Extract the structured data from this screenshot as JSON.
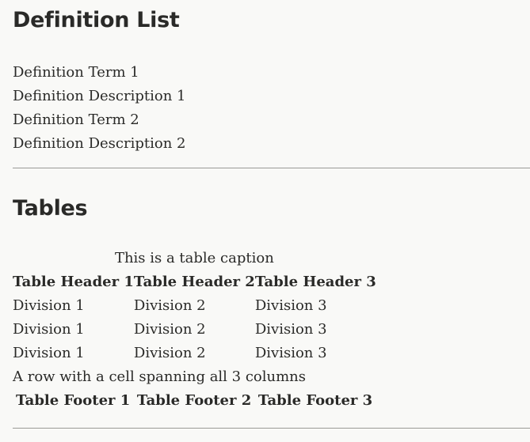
{
  "definition_list": {
    "heading": "Definition List",
    "items": [
      {
        "term": "Definition Term 1",
        "description": "Definition Description 1"
      },
      {
        "term": "Definition Term 2",
        "description": "Definition Description 2"
      }
    ]
  },
  "tables_section": {
    "heading": "Tables",
    "caption": "This is a table caption",
    "headers": [
      "Table Header 1",
      "Table Header 2",
      "Table Header 3"
    ],
    "rows": [
      [
        "Division 1",
        "Division 2",
        "Division 3"
      ],
      [
        "Division 1",
        "Division 2",
        "Division 3"
      ],
      [
        "Division 1",
        "Division 2",
        "Division 3"
      ]
    ],
    "spanning_row": "A row with a cell spanning all 3 columns",
    "footers": [
      "Table Footer 1",
      "Table Footer 2",
      "Table Footer 3"
    ]
  }
}
